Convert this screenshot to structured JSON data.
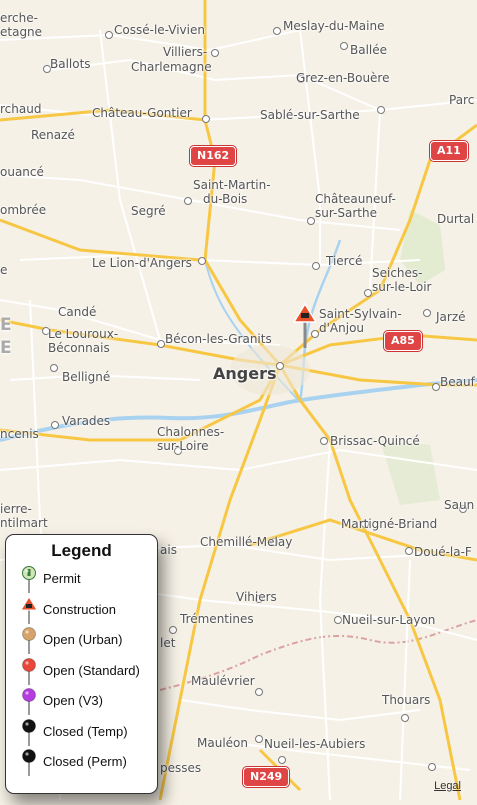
{
  "map": {
    "labels": {
      "cosse": "Cossé-le-Vivien",
      "meslay": "Meslay-du-Maine",
      "ballee": "Ballée",
      "villiers": "Villiers-",
      "charlemagne": "Charlemagne",
      "ballots": "Ballots",
      "grez": "Grez-en-Bouère",
      "cherche": "erche-",
      "etagne": "etagne",
      "parce": "Parc",
      "chaudron": "rchaud",
      "chateau_gontier": "Château-Gontier",
      "sable": "Sablé-sur-Sarthe",
      "renaze": "Renazé",
      "saint_martin": "Saint-Martin-",
      "du_bois": "du-Bois",
      "oancee": "ouancé",
      "chateauneuf": "Châteauneuf-",
      "sur_sarthe": "sur-Sarthe",
      "durtal": "Durtal",
      "ombree": "ombrée",
      "segre": "Segré",
      "lion": "Le Lion-d'Angers",
      "tierce": "Tiercé",
      "seiches": "Seiches-",
      "sur_le_loir": "sur-le-Loir",
      "e_edge": "e",
      "sylvain": "Saint-Sylvain-",
      "danjou": "d'Anjou",
      "jarze": "Jarzé",
      "cande": "Candé",
      "louroux": "Le Louroux-",
      "beconnais": "Béconnais",
      "becon": "Bécon-les-Granits",
      "angers": "Angers",
      "belligne": "Belligné",
      "beauf": "Beauf",
      "ghost_e": "E",
      "ghost_e2": "E",
      "varades": "Varades",
      "ancenis": "ncenis",
      "chalonnes": "Chalonnes-",
      "sur_loire": "sur-Loire",
      "brissac": "Brissac-Quincé",
      "saun": "Saun",
      "ierre": "ierre-",
      "ntilmart": "ntilmart",
      "martigne": "Martigné-Briand",
      "chemille": "Chemillé-Melay",
      "doue": "Doué-la-F",
      "ais": "ais",
      "vihiers": "Vihiers",
      "nueil_layon": "Nueil-sur-Layon",
      "trementines": "Trémentines",
      "let": "let",
      "maulevrier": "Maulévrier",
      "thouars": "Thouars",
      "mauleon": "Mauléon",
      "nueil_aubiers": "Nueil-les-Aubiers",
      "pesses": "pesses"
    },
    "shields": {
      "n162": "N162",
      "a11": "A11",
      "a85": "A85",
      "n249": "N249"
    },
    "legal": "Legal",
    "colors": {
      "land": "#f6f1e6",
      "major_road": "#f7c744",
      "road": "#ffffff",
      "water": "#a9d2f1",
      "border": "#d9a3a3",
      "shield": "#e04545"
    }
  },
  "legend": {
    "title": "Legend",
    "items": [
      {
        "label": "Permit",
        "icon": "permit-pin-icon",
        "color": "#cfe7b6"
      },
      {
        "label": "Construction",
        "icon": "construction-pin-icon",
        "color": "#e8502a"
      },
      {
        "label": "Open (Urban)",
        "icon": "urban-pin-icon",
        "color": "#d6a46a"
      },
      {
        "label": "Open (Standard)",
        "icon": "standard-pin-icon",
        "color": "#e8483a"
      },
      {
        "label": "Open (V3)",
        "icon": "v3-pin-icon",
        "color": "#b43ce0"
      },
      {
        "label": "Closed (Temp)",
        "icon": "temp-closed-pin-icon",
        "color": "#111111"
      },
      {
        "label": "Closed (Perm)",
        "icon": "perm-closed-pin-icon",
        "color": "#111111"
      }
    ]
  }
}
